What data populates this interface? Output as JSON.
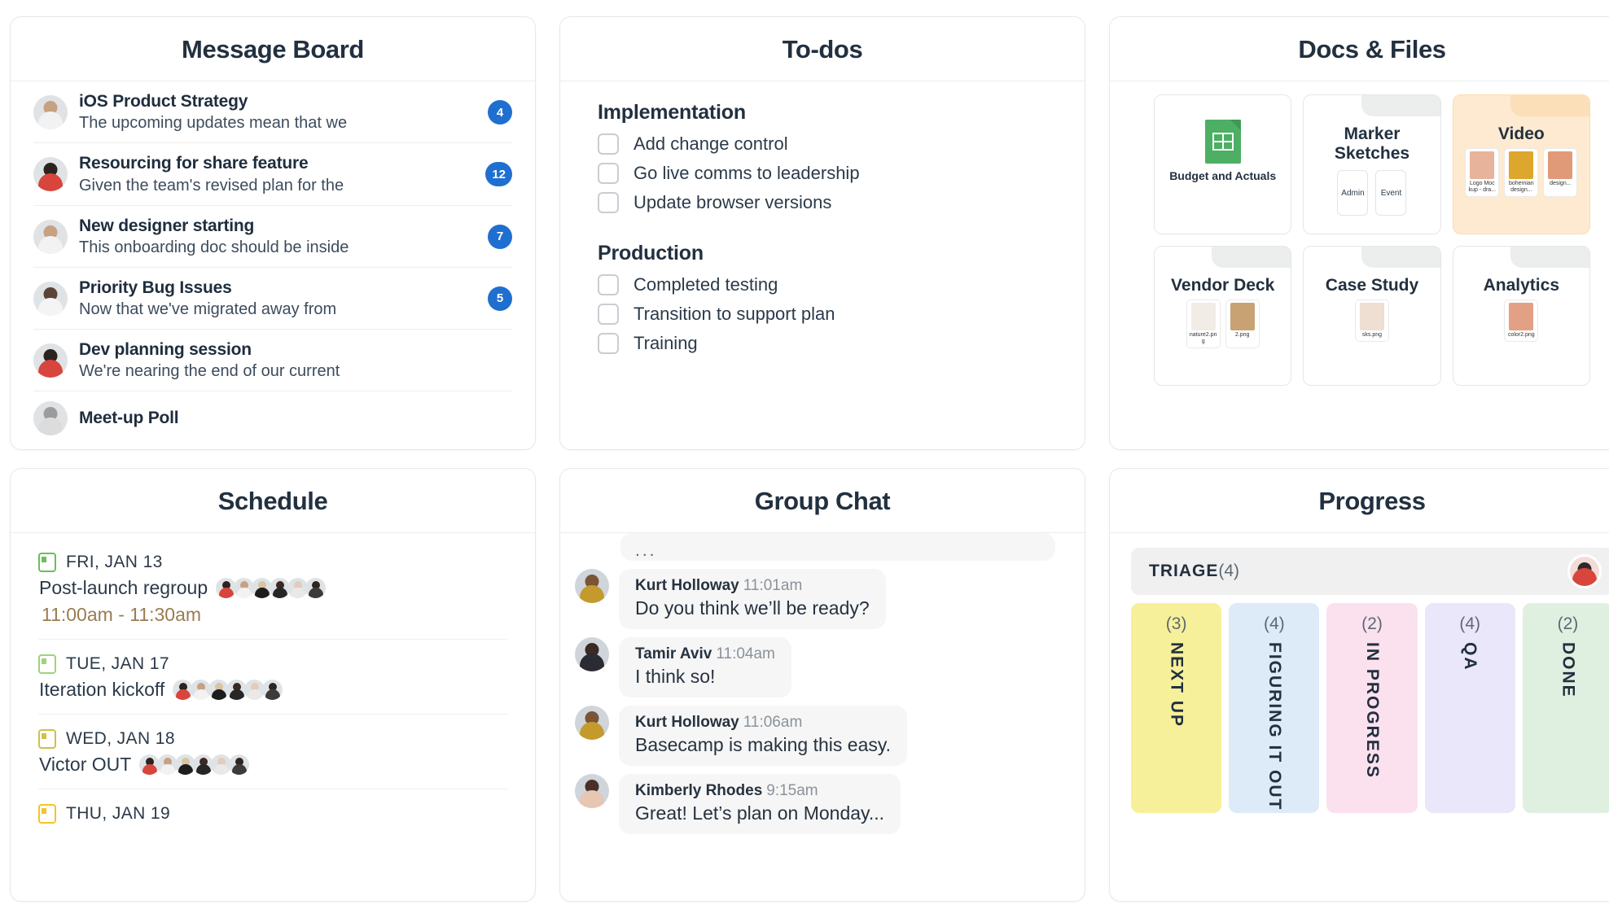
{
  "cards": {
    "message_board": {
      "title": "Message Board"
    },
    "todos": {
      "title": "To-dos"
    },
    "docs": {
      "title": "Docs & Files"
    },
    "schedule": {
      "title": "Schedule"
    },
    "chat": {
      "title": "Group Chat"
    },
    "progress": {
      "title": "Progress"
    }
  },
  "message_board": {
    "items": [
      {
        "title": "iOS Product Strategy",
        "preview": "The upcoming updates mean that we",
        "count": "4",
        "avatar": "avatar-bearded-man"
      },
      {
        "title": "Resourcing for share feature",
        "preview": "Given the team's revised plan for the",
        "count": "12",
        "avatar": "avatar-woman-dark-hair"
      },
      {
        "title": "New designer starting",
        "preview": "This onboarding doc should be inside",
        "count": "7",
        "avatar": "avatar-bearded-man"
      },
      {
        "title": "Priority Bug Issues",
        "preview": "Now that we've migrated away from",
        "count": "5",
        "avatar": "avatar-woman-lab-coat"
      },
      {
        "title": "Dev planning session",
        "preview": "We're nearing the end of our current",
        "count": "",
        "avatar": "avatar-woman-red-top"
      },
      {
        "title": "Meet-up Poll",
        "preview": "",
        "count": "",
        "avatar": "avatar-older-woman"
      }
    ],
    "badge_color": "#1f6fd0"
  },
  "todos": {
    "groups": [
      {
        "name": "Implementation",
        "items": [
          "Add change control",
          "Go live comms to leadership",
          "Update browser versions"
        ]
      },
      {
        "name": "Production",
        "items": [
          "Completed testing",
          "Transition to support plan",
          "Training"
        ]
      }
    ]
  },
  "docs": {
    "folders": [
      {
        "name": "Budget and Actuals",
        "kind": "sheet-file",
        "icon": "google-sheets-icon",
        "highlight": false,
        "chips": [],
        "thumbs": []
      },
      {
        "name": "Marker Sketches",
        "kind": "folder",
        "highlight": false,
        "chips": [
          "Admin",
          "Event"
        ],
        "thumbs": []
      },
      {
        "name": "Video",
        "kind": "folder",
        "highlight": true,
        "chips": [],
        "thumbs": [
          {
            "label": "Logo Mockup - dra...",
            "swatch": "pic-a"
          },
          {
            "label": "bohemian design...",
            "swatch": "pic-b"
          },
          {
            "label": "design...",
            "swatch": "pic-c"
          }
        ]
      },
      {
        "name": "Vendor Deck",
        "kind": "folder",
        "highlight": false,
        "chips": [],
        "thumbs": [
          {
            "label": "nature2.png",
            "swatch": "pic-d"
          },
          {
            "label": "2.png",
            "swatch": "pic-e"
          }
        ]
      },
      {
        "name": "Case Study",
        "kind": "folder",
        "highlight": false,
        "chips": [],
        "thumbs": [
          {
            "label": "sks.png",
            "swatch": "pic-f"
          }
        ]
      },
      {
        "name": "Analytics",
        "kind": "folder",
        "highlight": false,
        "chips": [],
        "thumbs": [
          {
            "label": "color2.png",
            "swatch": "pic-g"
          }
        ]
      }
    ],
    "accent_color": "#fdead0"
  },
  "schedule": {
    "events": [
      {
        "day": "FRI, JAN 13",
        "title": "Post-launch regroup",
        "time": "11:00am - 11:30am",
        "icon_color": "green",
        "attendees": 6
      },
      {
        "day": "TUE, JAN 17",
        "title": "Iteration kickoff",
        "time": "",
        "icon_color": "lgreen",
        "attendees": 6
      },
      {
        "day": "WED, JAN 18",
        "title": "Victor OUT",
        "time": "",
        "icon_color": "olive",
        "attendees": 6
      },
      {
        "day": "THU, JAN 19",
        "title": "",
        "time": "",
        "icon_color": "gold",
        "attendees": 0
      }
    ],
    "time_color": "#9a7c52"
  },
  "chat": {
    "truncated_bubble": "...",
    "messages": [
      {
        "name": "Kurt Holloway",
        "time": "11:01am",
        "text": "Do you think we’ll be ready?",
        "avatar": "avatar-man-smiling"
      },
      {
        "name": "Tamir Aviv",
        "time": "11:04am",
        "text": "I think so!",
        "avatar": "avatar-man-dark-jacket"
      },
      {
        "name": "Kurt Holloway",
        "time": "11:06am",
        "text": "Basecamp is making this easy.",
        "avatar": "avatar-man-smiling"
      },
      {
        "name": "Kimberly Rhodes",
        "time": "9:15am",
        "text": "Great! Let’s plan on Monday...",
        "avatar": "avatar-woman-curly-hair"
      }
    ]
  },
  "progress": {
    "triage": {
      "label": "TRIAGE",
      "count": "(4)"
    },
    "columns": [
      {
        "name": "NEXT UP",
        "count": "(3)",
        "color": "#f7f09a"
      },
      {
        "name": "FIGURING IT OUT",
        "count": "(4)",
        "color": "#ddeaf8"
      },
      {
        "name": "IN PROGRESS",
        "count": "(2)",
        "color": "#fbe1ee"
      },
      {
        "name": "QA",
        "count": "(4)",
        "color": "#ebe7fa"
      },
      {
        "name": "DONE",
        "count": "(2)",
        "color": "#dff0e0"
      }
    ]
  }
}
